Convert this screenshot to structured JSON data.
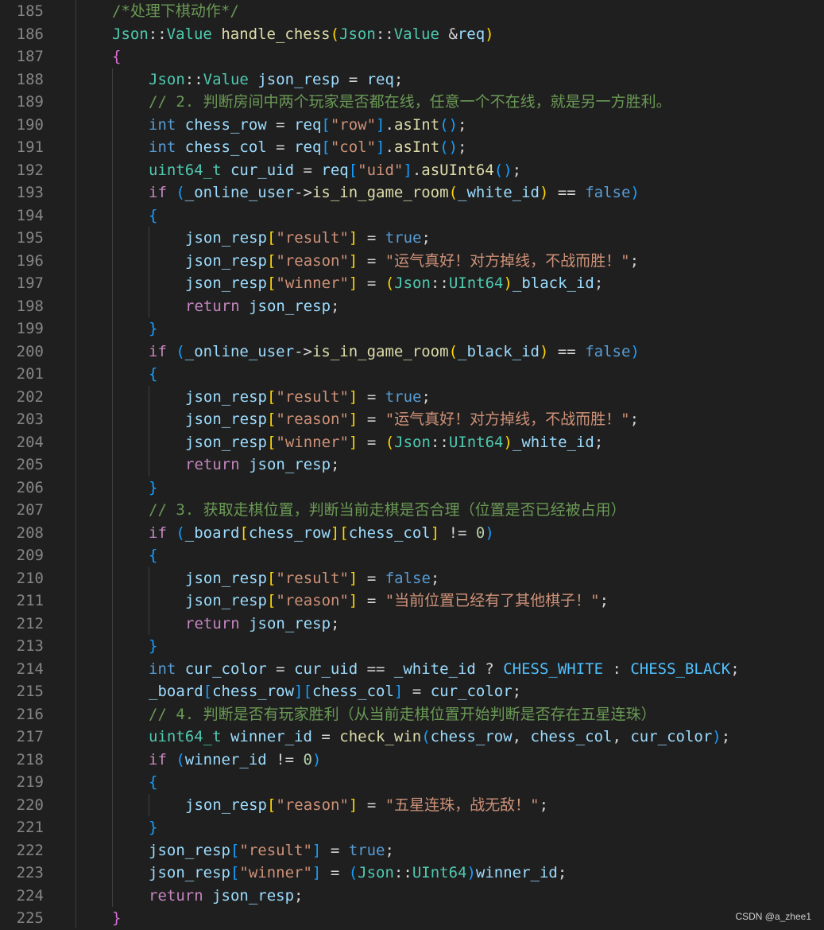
{
  "watermark": "CSDN @a_zhee1",
  "colors": {
    "background": "#1f1f1f",
    "comment": "#6a9955",
    "type": "#4ec9b0",
    "function": "#dcdcaa",
    "variable": "#9cdcfe",
    "keyword": "#569cd6",
    "control": "#c586c0",
    "string": "#ce9178",
    "number": "#b5cea8",
    "bracket_level1": "#ffd700",
    "bracket_level2": "#da70d6",
    "bracket_level3": "#179fff",
    "constant": "#4fc1ff",
    "line_number": "#858585"
  },
  "lines": [
    {
      "n": "185",
      "indent": 1,
      "tokens": [
        [
          "/*处理下棋动作*/",
          "comment"
        ]
      ]
    },
    {
      "n": "186",
      "indent": 1,
      "tokens": [
        [
          "Json",
          "type"
        ],
        [
          "::",
          "op"
        ],
        [
          "Value",
          "type"
        ],
        [
          " ",
          "op"
        ],
        [
          "handle_chess",
          "func"
        ],
        [
          "(",
          "b1"
        ],
        [
          "Json",
          "type"
        ],
        [
          "::",
          "op"
        ],
        [
          "Value",
          "type"
        ],
        [
          " ",
          "op"
        ],
        [
          "&",
          "op"
        ],
        [
          "req",
          "var"
        ],
        [
          ")",
          "b1"
        ]
      ]
    },
    {
      "n": "187",
      "indent": 1,
      "tokens": [
        [
          "{",
          "b2"
        ]
      ]
    },
    {
      "n": "188",
      "indent": 2,
      "tokens": [
        [
          "Json",
          "type"
        ],
        [
          "::",
          "op"
        ],
        [
          "Value",
          "type"
        ],
        [
          " ",
          "op"
        ],
        [
          "json_resp",
          "var"
        ],
        [
          " = ",
          "op"
        ],
        [
          "req",
          "var"
        ],
        [
          ";",
          "op"
        ]
      ]
    },
    {
      "n": "189",
      "indent": 2,
      "tokens": [
        [
          "// 2. 判断房间中两个玩家是否都在线，任意一个不在线，就是另一方胜利。",
          "comment"
        ]
      ]
    },
    {
      "n": "190",
      "indent": 2,
      "tokens": [
        [
          "int",
          "kw"
        ],
        [
          " ",
          "op"
        ],
        [
          "chess_row",
          "var"
        ],
        [
          " = ",
          "op"
        ],
        [
          "req",
          "var"
        ],
        [
          "[",
          "b3"
        ],
        [
          "\"row\"",
          "str"
        ],
        [
          "]",
          "b3"
        ],
        [
          ".",
          "op"
        ],
        [
          "asInt",
          "func"
        ],
        [
          "()",
          "b3"
        ],
        [
          ";",
          "op"
        ]
      ]
    },
    {
      "n": "191",
      "indent": 2,
      "tokens": [
        [
          "int",
          "kw"
        ],
        [
          " ",
          "op"
        ],
        [
          "chess_col",
          "var"
        ],
        [
          " = ",
          "op"
        ],
        [
          "req",
          "var"
        ],
        [
          "[",
          "b3"
        ],
        [
          "\"col\"",
          "str"
        ],
        [
          "]",
          "b3"
        ],
        [
          ".",
          "op"
        ],
        [
          "asInt",
          "func"
        ],
        [
          "()",
          "b3"
        ],
        [
          ";",
          "op"
        ]
      ]
    },
    {
      "n": "192",
      "indent": 2,
      "tokens": [
        [
          "uint64_t",
          "type"
        ],
        [
          " ",
          "op"
        ],
        [
          "cur_uid",
          "var"
        ],
        [
          " = ",
          "op"
        ],
        [
          "req",
          "var"
        ],
        [
          "[",
          "b3"
        ],
        [
          "\"uid\"",
          "str"
        ],
        [
          "]",
          "b3"
        ],
        [
          ".",
          "op"
        ],
        [
          "asUInt64",
          "func"
        ],
        [
          "()",
          "b3"
        ],
        [
          ";",
          "op"
        ]
      ]
    },
    {
      "n": "193",
      "indent": 2,
      "tokens": [
        [
          "if",
          "ctrl"
        ],
        [
          " ",
          "op"
        ],
        [
          "(",
          "b3"
        ],
        [
          "_online_user",
          "var"
        ],
        [
          "->",
          "op"
        ],
        [
          "is_in_game_room",
          "func"
        ],
        [
          "(",
          "b1"
        ],
        [
          "_white_id",
          "var"
        ],
        [
          ")",
          "b1"
        ],
        [
          " == ",
          "op"
        ],
        [
          "false",
          "kw"
        ],
        [
          ")",
          "b3"
        ]
      ]
    },
    {
      "n": "194",
      "indent": 2,
      "tokens": [
        [
          "{",
          "b3"
        ]
      ]
    },
    {
      "n": "195",
      "indent": 3,
      "tokens": [
        [
          "json_resp",
          "var"
        ],
        [
          "[",
          "b1"
        ],
        [
          "\"result\"",
          "str"
        ],
        [
          "]",
          "b1"
        ],
        [
          " = ",
          "op"
        ],
        [
          "true",
          "kw"
        ],
        [
          ";",
          "op"
        ]
      ]
    },
    {
      "n": "196",
      "indent": 3,
      "tokens": [
        [
          "json_resp",
          "var"
        ],
        [
          "[",
          "b1"
        ],
        [
          "\"reason\"",
          "str"
        ],
        [
          "]",
          "b1"
        ],
        [
          " = ",
          "op"
        ],
        [
          "\"运气真好！对方掉线，不战而胜！\"",
          "str"
        ],
        [
          ";",
          "op"
        ]
      ]
    },
    {
      "n": "197",
      "indent": 3,
      "tokens": [
        [
          "json_resp",
          "var"
        ],
        [
          "[",
          "b1"
        ],
        [
          "\"winner\"",
          "str"
        ],
        [
          "]",
          "b1"
        ],
        [
          " = ",
          "op"
        ],
        [
          "(",
          "b1"
        ],
        [
          "Json",
          "type"
        ],
        [
          "::",
          "op"
        ],
        [
          "UInt64",
          "type"
        ],
        [
          ")",
          "b1"
        ],
        [
          "_black_id",
          "var"
        ],
        [
          ";",
          "op"
        ]
      ]
    },
    {
      "n": "198",
      "indent": 3,
      "tokens": [
        [
          "return",
          "ctrl"
        ],
        [
          " ",
          "op"
        ],
        [
          "json_resp",
          "var"
        ],
        [
          ";",
          "op"
        ]
      ]
    },
    {
      "n": "199",
      "indent": 2,
      "tokens": [
        [
          "}",
          "b3"
        ]
      ]
    },
    {
      "n": "200",
      "indent": 2,
      "tokens": [
        [
          "if",
          "ctrl"
        ],
        [
          " ",
          "op"
        ],
        [
          "(",
          "b3"
        ],
        [
          "_online_user",
          "var"
        ],
        [
          "->",
          "op"
        ],
        [
          "is_in_game_room",
          "func"
        ],
        [
          "(",
          "b1"
        ],
        [
          "_black_id",
          "var"
        ],
        [
          ")",
          "b1"
        ],
        [
          " == ",
          "op"
        ],
        [
          "false",
          "kw"
        ],
        [
          ")",
          "b3"
        ]
      ]
    },
    {
      "n": "201",
      "indent": 2,
      "tokens": [
        [
          "{",
          "b3"
        ]
      ]
    },
    {
      "n": "202",
      "indent": 3,
      "tokens": [
        [
          "json_resp",
          "var"
        ],
        [
          "[",
          "b1"
        ],
        [
          "\"result\"",
          "str"
        ],
        [
          "]",
          "b1"
        ],
        [
          " = ",
          "op"
        ],
        [
          "true",
          "kw"
        ],
        [
          ";",
          "op"
        ]
      ]
    },
    {
      "n": "203",
      "indent": 3,
      "tokens": [
        [
          "json_resp",
          "var"
        ],
        [
          "[",
          "b1"
        ],
        [
          "\"reason\"",
          "str"
        ],
        [
          "]",
          "b1"
        ],
        [
          " = ",
          "op"
        ],
        [
          "\"运气真好！对方掉线，不战而胜！\"",
          "str"
        ],
        [
          ";",
          "op"
        ]
      ]
    },
    {
      "n": "204",
      "indent": 3,
      "tokens": [
        [
          "json_resp",
          "var"
        ],
        [
          "[",
          "b1"
        ],
        [
          "\"winner\"",
          "str"
        ],
        [
          "]",
          "b1"
        ],
        [
          " = ",
          "op"
        ],
        [
          "(",
          "b1"
        ],
        [
          "Json",
          "type"
        ],
        [
          "::",
          "op"
        ],
        [
          "UInt64",
          "type"
        ],
        [
          ")",
          "b1"
        ],
        [
          "_white_id",
          "var"
        ],
        [
          ";",
          "op"
        ]
      ]
    },
    {
      "n": "205",
      "indent": 3,
      "tokens": [
        [
          "return",
          "ctrl"
        ],
        [
          " ",
          "op"
        ],
        [
          "json_resp",
          "var"
        ],
        [
          ";",
          "op"
        ]
      ]
    },
    {
      "n": "206",
      "indent": 2,
      "tokens": [
        [
          "}",
          "b3"
        ]
      ]
    },
    {
      "n": "207",
      "indent": 2,
      "tokens": [
        [
          "// 3. 获取走棋位置，判断当前走棋是否合理（位置是否已经被占用）",
          "comment"
        ]
      ]
    },
    {
      "n": "208",
      "indent": 2,
      "tokens": [
        [
          "if",
          "ctrl"
        ],
        [
          " ",
          "op"
        ],
        [
          "(",
          "b3"
        ],
        [
          "_board",
          "var"
        ],
        [
          "[",
          "b1"
        ],
        [
          "chess_row",
          "var"
        ],
        [
          "]",
          "b1"
        ],
        [
          "[",
          "b1"
        ],
        [
          "chess_col",
          "var"
        ],
        [
          "]",
          "b1"
        ],
        [
          " != ",
          "op"
        ],
        [
          "0",
          "num"
        ],
        [
          ")",
          "b3"
        ]
      ]
    },
    {
      "n": "209",
      "indent": 2,
      "tokens": [
        [
          "{",
          "b3"
        ]
      ]
    },
    {
      "n": "210",
      "indent": 3,
      "tokens": [
        [
          "json_resp",
          "var"
        ],
        [
          "[",
          "b1"
        ],
        [
          "\"result\"",
          "str"
        ],
        [
          "]",
          "b1"
        ],
        [
          " = ",
          "op"
        ],
        [
          "false",
          "kw"
        ],
        [
          ";",
          "op"
        ]
      ]
    },
    {
      "n": "211",
      "indent": 3,
      "tokens": [
        [
          "json_resp",
          "var"
        ],
        [
          "[",
          "b1"
        ],
        [
          "\"reason\"",
          "str"
        ],
        [
          "]",
          "b1"
        ],
        [
          " = ",
          "op"
        ],
        [
          "\"当前位置已经有了其他棋子！\"",
          "str"
        ],
        [
          ";",
          "op"
        ]
      ]
    },
    {
      "n": "212",
      "indent": 3,
      "tokens": [
        [
          "return",
          "ctrl"
        ],
        [
          " ",
          "op"
        ],
        [
          "json_resp",
          "var"
        ],
        [
          ";",
          "op"
        ]
      ]
    },
    {
      "n": "213",
      "indent": 2,
      "tokens": [
        [
          "}",
          "b3"
        ]
      ]
    },
    {
      "n": "214",
      "indent": 2,
      "tokens": [
        [
          "int",
          "kw"
        ],
        [
          " ",
          "op"
        ],
        [
          "cur_color",
          "var"
        ],
        [
          " = ",
          "op"
        ],
        [
          "cur_uid",
          "var"
        ],
        [
          " == ",
          "op"
        ],
        [
          "_white_id",
          "var"
        ],
        [
          " ? ",
          "op"
        ],
        [
          "CHESS_WHITE",
          "const"
        ],
        [
          " : ",
          "op"
        ],
        [
          "CHESS_BLACK",
          "const"
        ],
        [
          ";",
          "op"
        ]
      ]
    },
    {
      "n": "215",
      "indent": 2,
      "tokens": [
        [
          "_board",
          "var"
        ],
        [
          "[",
          "b3"
        ],
        [
          "chess_row",
          "var"
        ],
        [
          "]",
          "b3"
        ],
        [
          "[",
          "b3"
        ],
        [
          "chess_col",
          "var"
        ],
        [
          "]",
          "b3"
        ],
        [
          " = ",
          "op"
        ],
        [
          "cur_color",
          "var"
        ],
        [
          ";",
          "op"
        ]
      ]
    },
    {
      "n": "216",
      "indent": 2,
      "tokens": [
        [
          "// 4. 判断是否有玩家胜利（从当前走棋位置开始判断是否存在五星连珠）",
          "comment"
        ]
      ]
    },
    {
      "n": "217",
      "indent": 2,
      "tokens": [
        [
          "uint64_t",
          "type"
        ],
        [
          " ",
          "op"
        ],
        [
          "winner_id",
          "var"
        ],
        [
          " = ",
          "op"
        ],
        [
          "check_win",
          "func"
        ],
        [
          "(",
          "b3"
        ],
        [
          "chess_row",
          "var"
        ],
        [
          ", ",
          "op"
        ],
        [
          "chess_col",
          "var"
        ],
        [
          ", ",
          "op"
        ],
        [
          "cur_color",
          "var"
        ],
        [
          ")",
          "b3"
        ],
        [
          ";",
          "op"
        ]
      ]
    },
    {
      "n": "218",
      "indent": 2,
      "tokens": [
        [
          "if",
          "ctrl"
        ],
        [
          " ",
          "op"
        ],
        [
          "(",
          "b3"
        ],
        [
          "winner_id",
          "var"
        ],
        [
          " != ",
          "op"
        ],
        [
          "0",
          "num"
        ],
        [
          ")",
          "b3"
        ]
      ]
    },
    {
      "n": "219",
      "indent": 2,
      "tokens": [
        [
          "{",
          "b3"
        ]
      ]
    },
    {
      "n": "220",
      "indent": 3,
      "tokens": [
        [
          "json_resp",
          "var"
        ],
        [
          "[",
          "b1"
        ],
        [
          "\"reason\"",
          "str"
        ],
        [
          "]",
          "b1"
        ],
        [
          " = ",
          "op"
        ],
        [
          "\"五星连珠，战无敌！\"",
          "str"
        ],
        [
          ";",
          "op"
        ]
      ]
    },
    {
      "n": "221",
      "indent": 2,
      "tokens": [
        [
          "}",
          "b3"
        ]
      ]
    },
    {
      "n": "222",
      "indent": 2,
      "tokens": [
        [
          "json_resp",
          "var"
        ],
        [
          "[",
          "b3"
        ],
        [
          "\"result\"",
          "str"
        ],
        [
          "]",
          "b3"
        ],
        [
          " = ",
          "op"
        ],
        [
          "true",
          "kw"
        ],
        [
          ";",
          "op"
        ]
      ]
    },
    {
      "n": "223",
      "indent": 2,
      "tokens": [
        [
          "json_resp",
          "var"
        ],
        [
          "[",
          "b3"
        ],
        [
          "\"winner\"",
          "str"
        ],
        [
          "]",
          "b3"
        ],
        [
          " = ",
          "op"
        ],
        [
          "(",
          "b3"
        ],
        [
          "Json",
          "type"
        ],
        [
          "::",
          "op"
        ],
        [
          "UInt64",
          "type"
        ],
        [
          ")",
          "b3"
        ],
        [
          "winner_id",
          "var"
        ],
        [
          ";",
          "op"
        ]
      ]
    },
    {
      "n": "224",
      "indent": 2,
      "tokens": [
        [
          "return",
          "ctrl"
        ],
        [
          " ",
          "op"
        ],
        [
          "json_resp",
          "var"
        ],
        [
          ";",
          "op"
        ]
      ]
    },
    {
      "n": "225",
      "indent": 1,
      "tokens": [
        [
          "}",
          "b2"
        ]
      ]
    }
  ]
}
